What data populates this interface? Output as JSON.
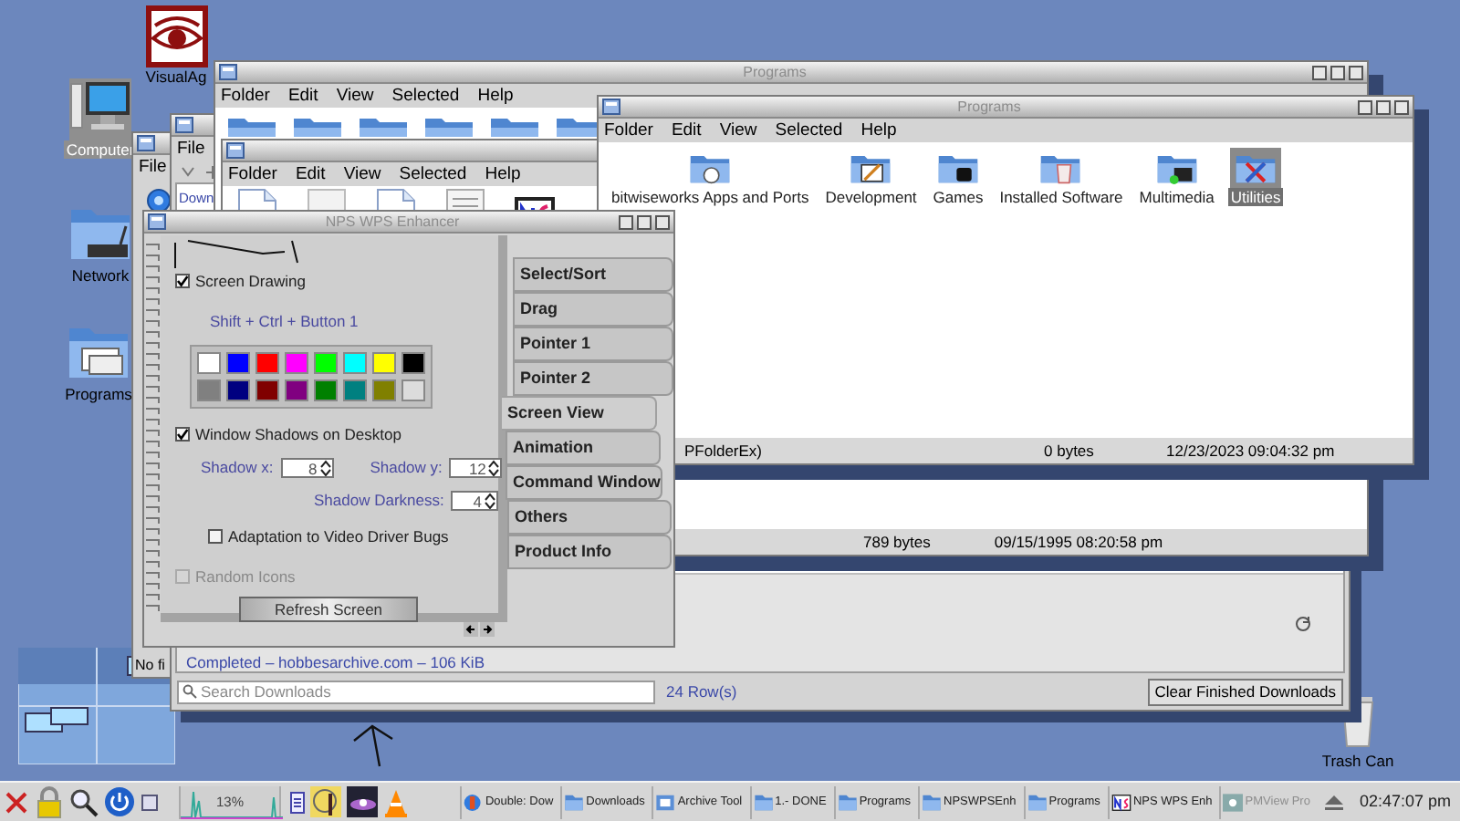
{
  "desktop_icons": [
    {
      "label": "VisualAg",
      "selected": false
    },
    {
      "label": "Computer",
      "selected": true
    },
    {
      "label": "Network",
      "selected": false
    },
    {
      "label": "Programs",
      "selected": false
    },
    {
      "label": "Trash Can",
      "selected": false
    }
  ],
  "hidden_window": {
    "menu": [
      "File"
    ],
    "status": "No fi"
  },
  "downloads": {
    "menu": [
      "File"
    ],
    "item_title": "Down",
    "item_status": "Completed – hobbesarchive.com – 106 KiB",
    "search": {
      "placeholder": "Search Downloads"
    },
    "row_count": "24 Row(s)",
    "clear_button": "Clear Finished Downloads"
  },
  "back_folder": {
    "title": "Programs",
    "menu": [
      "Folder",
      "Edit",
      "View",
      "Selected",
      "Help"
    ],
    "status": [
      "789 bytes",
      "09/15/1995 08:20:58 pm"
    ]
  },
  "middle_folder": {
    "menu": [
      "Folder",
      "Edit",
      "View",
      "Selected",
      "Help"
    ]
  },
  "front_folder": {
    "title": "Programs",
    "menu": [
      "Folder",
      "Edit",
      "View",
      "Selected",
      "Help"
    ],
    "icons": [
      {
        "label": "bitwiseworks Apps and Ports",
        "selected": false
      },
      {
        "label": "Development",
        "selected": false
      },
      {
        "label": "Games",
        "selected": false
      },
      {
        "label": "Installed Software",
        "selected": false
      },
      {
        "label": "Multimedia",
        "selected": false
      },
      {
        "label": "Utilities",
        "selected": true
      }
    ],
    "status": [
      "PFolderEx)",
      "0 bytes",
      "12/23/2023 09:04:32 pm"
    ]
  },
  "enhancer": {
    "title": "NPS WPS Enhancer",
    "screen_drawing": {
      "label": "Screen Drawing",
      "checked": true
    },
    "hint": "Shift + Ctrl + Button 1",
    "palette": [
      {
        "color": "#ffffff"
      },
      {
        "color": "#0000ff"
      },
      {
        "color": "#ff0000"
      },
      {
        "color": "#ff00ff"
      },
      {
        "color": "#00ff00"
      },
      {
        "color": "#00ffff"
      },
      {
        "color": "#ffff00"
      },
      {
        "color": "#000000"
      },
      {
        "color": "#808080"
      },
      {
        "color": "#000080"
      },
      {
        "color": "#800000"
      },
      {
        "color": "#800080"
      },
      {
        "color": "#008000"
      },
      {
        "color": "#008080"
      },
      {
        "color": "#808000"
      },
      {
        "color": "#dcdcdc"
      }
    ],
    "window_shadows": {
      "label": "Window Shadows on Desktop",
      "checked": true
    },
    "shadow_x": {
      "label": "Shadow x:",
      "value": "8"
    },
    "shadow_y": {
      "label": "Shadow y:",
      "value": "12"
    },
    "shadow_darkness": {
      "label": "Shadow Darkness:",
      "value": "4"
    },
    "video_bugs": {
      "label": "Adaptation to Video Driver Bugs",
      "checked": false
    },
    "random_icons": {
      "label": "Random Icons",
      "checked": false,
      "disabled": true
    },
    "refresh_button": "Refresh Screen",
    "tabs": [
      {
        "label": "Select/Sort",
        "selected": false
      },
      {
        "label": "Drag",
        "selected": false
      },
      {
        "label": "Pointer 1",
        "selected": false
      },
      {
        "label": "Pointer 2",
        "selected": false
      },
      {
        "label": "Screen View",
        "selected": true
      },
      {
        "label": "Animation",
        "selected": false
      },
      {
        "label": "Command Window",
        "selected": false
      },
      {
        "label": "Others",
        "selected": false
      },
      {
        "label": "Product Info",
        "selected": false
      }
    ]
  },
  "taskbar": {
    "cpu_reading": "13%",
    "tasks": [
      {
        "label": "Double: Dow",
        "disabled": false
      },
      {
        "label": "Downloads",
        "disabled": false
      },
      {
        "label": "Archive Tool",
        "disabled": false
      },
      {
        "label": "1.- DONE",
        "disabled": false
      },
      {
        "label": "Programs",
        "disabled": false
      },
      {
        "label": "NPSWPSEnh",
        "disabled": false
      },
      {
        "label": "Programs",
        "disabled": false
      },
      {
        "label": "NPS WPS Enh",
        "disabled": false
      },
      {
        "label": "PMView Pro",
        "disabled": true
      }
    ],
    "clock": "02:47:07 pm"
  }
}
